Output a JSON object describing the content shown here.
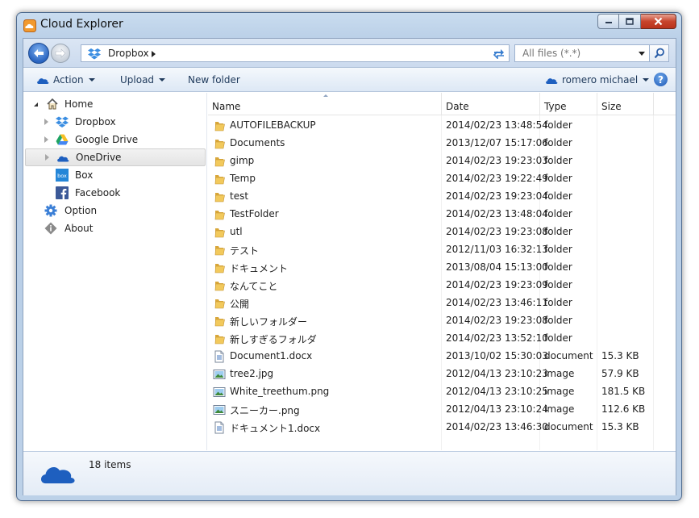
{
  "window": {
    "title": "Cloud Explorer"
  },
  "address": {
    "location": "Dropbox",
    "search_placeholder": "All files (*.*)"
  },
  "toolbar": {
    "action_label": "Action",
    "upload_label": "Upload",
    "new_folder_label": "New folder",
    "user_label": "romero michael",
    "help_label": "?"
  },
  "sidebar": {
    "items": [
      {
        "label": "Home",
        "icon": "home-icon"
      },
      {
        "label": "Dropbox",
        "icon": "dropbox-icon"
      },
      {
        "label": "Google Drive",
        "icon": "google-drive-icon"
      },
      {
        "label": "OneDrive",
        "icon": "onedrive-icon",
        "selected": true
      },
      {
        "label": "Box",
        "icon": "box-icon"
      },
      {
        "label": "Facebook",
        "icon": "facebook-icon"
      },
      {
        "label": "Option",
        "icon": "gear-icon"
      },
      {
        "label": "About",
        "icon": "info-icon"
      }
    ]
  },
  "list": {
    "columns": [
      "Name",
      "Date",
      "Type",
      "Size"
    ],
    "rows": [
      {
        "name": "AUTOFILEBACKUP",
        "date": "2014/02/23 13:48:54",
        "type": "folder",
        "size": "",
        "icon": "folder-icon"
      },
      {
        "name": "Documents",
        "date": "2013/12/07 15:17:06",
        "type": "folder",
        "size": "",
        "icon": "folder-icon"
      },
      {
        "name": "gimp",
        "date": "2014/02/23 19:23:03",
        "type": "folder",
        "size": "",
        "icon": "folder-icon"
      },
      {
        "name": "Temp",
        "date": "2014/02/23 19:22:49",
        "type": "folder",
        "size": "",
        "icon": "folder-icon"
      },
      {
        "name": "test",
        "date": "2014/02/23 19:23:04",
        "type": "folder",
        "size": "",
        "icon": "folder-icon"
      },
      {
        "name": "TestFolder",
        "date": "2014/02/23 13:48:04",
        "type": "folder",
        "size": "",
        "icon": "folder-icon"
      },
      {
        "name": "utl",
        "date": "2014/02/23 19:23:08",
        "type": "folder",
        "size": "",
        "icon": "folder-icon"
      },
      {
        "name": "テスト",
        "date": "2012/11/03 16:32:13",
        "type": "folder",
        "size": "",
        "icon": "folder-icon"
      },
      {
        "name": "ドキュメント",
        "date": "2013/08/04 15:13:00",
        "type": "folder",
        "size": "",
        "icon": "folder-icon"
      },
      {
        "name": "なんてこと",
        "date": "2014/02/23 19:23:09",
        "type": "folder",
        "size": "",
        "icon": "folder-icon"
      },
      {
        "name": "公開",
        "date": "2014/02/23 13:46:11",
        "type": "folder",
        "size": "",
        "icon": "folder-icon"
      },
      {
        "name": "新しいフォルダー",
        "date": "2014/02/23 19:23:08",
        "type": "folder",
        "size": "",
        "icon": "folder-icon"
      },
      {
        "name": "新しすぎるフォルダ",
        "date": "2014/02/23 13:52:10",
        "type": "folder",
        "size": "",
        "icon": "folder-icon"
      },
      {
        "name": "Document1.docx",
        "date": "2013/10/02 15:30:03",
        "type": "document",
        "size": "15.3 KB",
        "icon": "document-icon"
      },
      {
        "name": "tree2.jpg",
        "date": "2012/04/13 23:10:23",
        "type": "image",
        "size": "57.9 KB",
        "icon": "image-icon"
      },
      {
        "name": "White_treethum.png",
        "date": "2012/04/13 23:10:25",
        "type": "image",
        "size": "181.5 KB",
        "icon": "image-icon"
      },
      {
        "name": "スニーカー.png",
        "date": "2012/04/13 23:10:24",
        "type": "image",
        "size": "112.6 KB",
        "icon": "image-icon"
      },
      {
        "name": "ドキュメント1.docx",
        "date": "2014/02/23 13:46:30",
        "type": "document",
        "size": "15.3 KB",
        "icon": "document-icon"
      }
    ]
  },
  "status": {
    "count": "18 items",
    "icon": "onedrive-icon"
  },
  "colors": {
    "accent": "#1e5fbf",
    "toolbar_text": "#1e395b",
    "folder": "#e8b84a"
  }
}
